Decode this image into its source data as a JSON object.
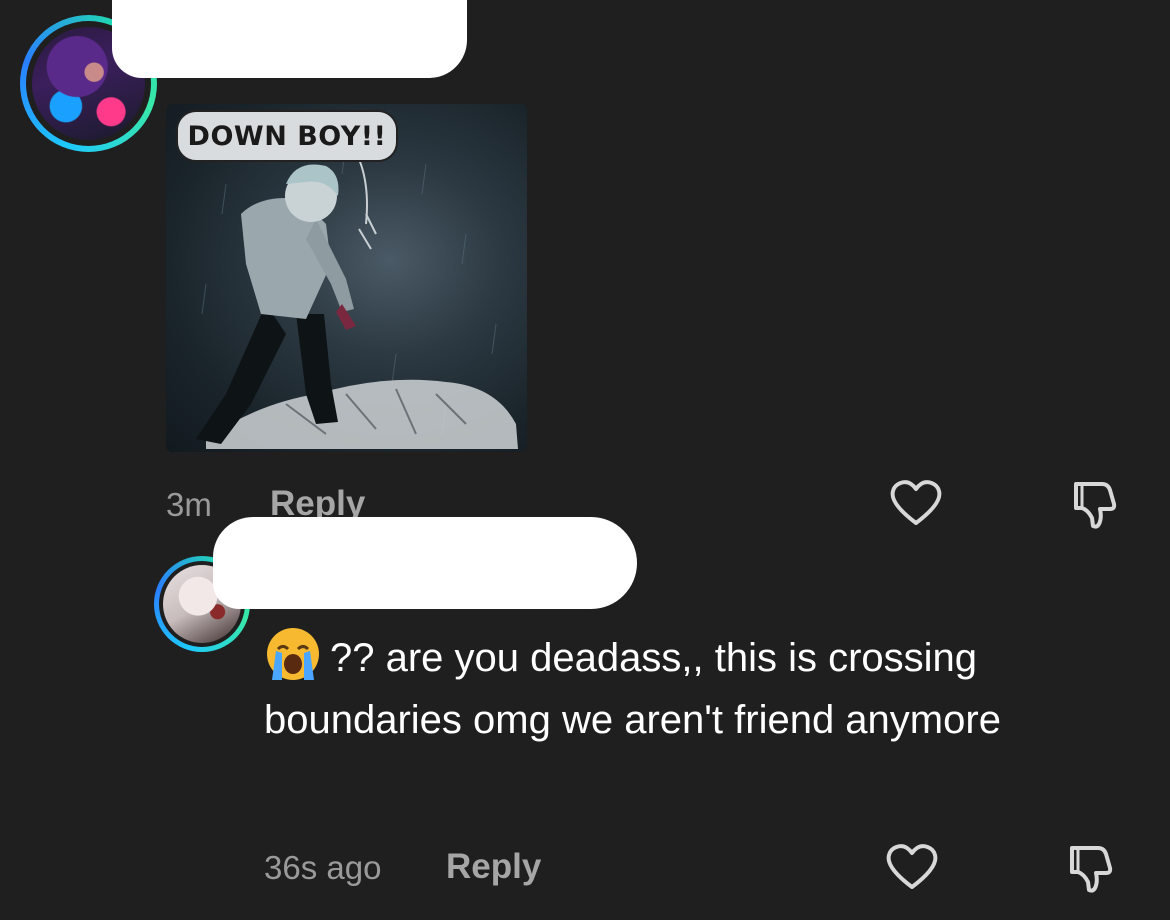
{
  "comments": [
    {
      "image_caption": "DOWN BOY!!",
      "time": "3m",
      "reply_label": "Reply"
    },
    {
      "text": "?? are you deadass,, this is crossing boundaries omg we aren't friend anymore",
      "emoji": "loudly-crying-face",
      "time": "36s ago",
      "reply_label": "Reply"
    }
  ],
  "icons": {
    "like": "heart-outline-icon",
    "dislike": "thumbs-down-outline-icon"
  },
  "colors": {
    "background": "#1f1f1f",
    "avatar_ring": "#1ec8ff",
    "meta_text": "#9a9a9a"
  }
}
